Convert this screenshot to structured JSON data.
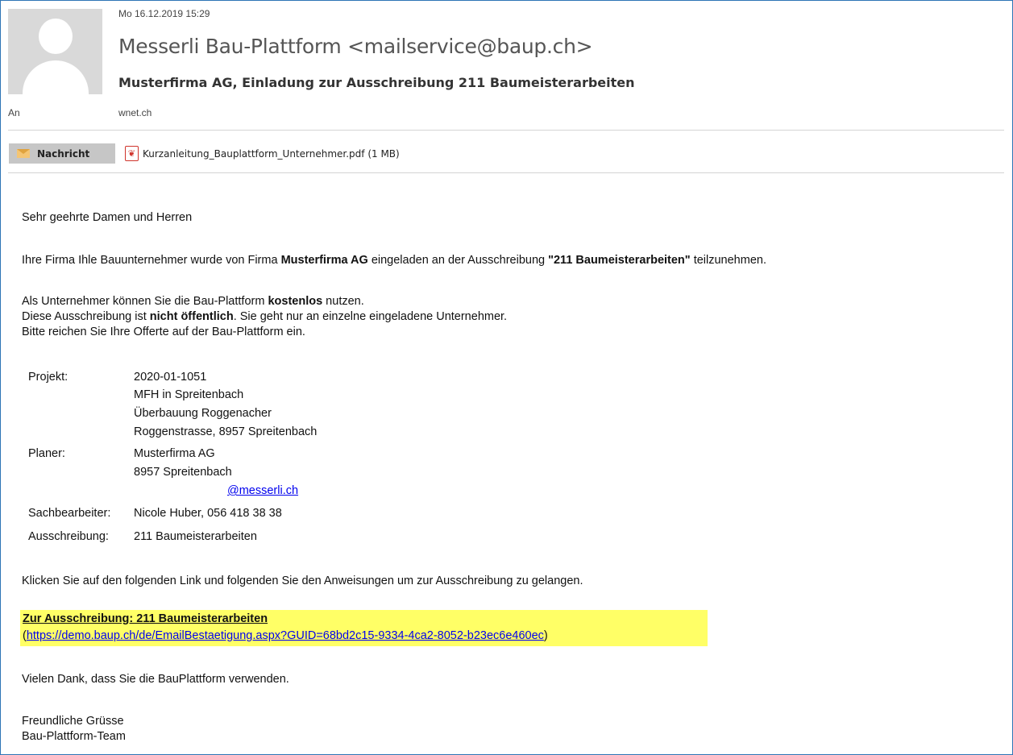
{
  "header": {
    "date": "Mo 16.12.2019 15:29",
    "sender": "Messerli Bau-Plattform <mailservice@baup.ch>",
    "subject": "Musterfirma AG, Einladung zur Ausschreibung 211 Baumeisterarbeiten",
    "to_label": "An",
    "to_value": "wnet.ch"
  },
  "tabs": {
    "message_label": "Nachricht",
    "attachment_name": "Kurzanleitung_Bauplattform_Unternehmer.pdf (1 MB)"
  },
  "body": {
    "greeting": "Sehr geehrte Damen und Herren",
    "intro_1": "Ihre Firma Ihle Bauunternehmer wurde von Firma ",
    "intro_company": "Musterfirma AG",
    "intro_2": " eingeladen an der Ausschreibung ",
    "intro_tender": "\"211 Baumeisterarbeiten\"",
    "intro_3": " teilzunehmen.",
    "free_1": "Als Unternehmer können Sie die Bau-Plattform ",
    "free_bold": "kostenlos",
    "free_2": " nutzen.",
    "private_1": "Diese Ausschreibung ist ",
    "private_bold": "nicht öffentlich",
    "private_2": ". Sie geht nur an einzelne eingeladene Unternehmer.",
    "submit": "Bitte reichen Sie Ihre Offerte auf der Bau-Plattform ein.",
    "details": {
      "project_label": "Projekt:",
      "project_lines": [
        "2020-01-1051",
        "MFH in Spreitenbach",
        "Überbauung Roggenacher",
        "Roggenstrasse, 8957 Spreitenbach"
      ],
      "planner_label": "Planer:",
      "planner_lines": [
        "Musterfirma AG",
        "8957 Spreitenbach"
      ],
      "planner_email_visible": "@messerli.ch",
      "clerk_label": "Sachbearbeiter:",
      "clerk_value": "Nicole Huber, 056 418 38 38",
      "tender_label": "Ausschreibung:",
      "tender_value": "211 Baumeisterarbeiten"
    },
    "instruction": "Klicken Sie auf den folgenden Link und folgenden Sie den Anweisungen um zur Ausschreibung zu gelangen.",
    "link_title": "Zur Ausschreibung: 211 Baumeisterarbeiten",
    "link_url": "https://demo.baup.ch/de/EmailBestaetigung.aspx?GUID=68bd2c15-9334-4ca2-8052-b23ec6e460ec",
    "thanks": "Vielen Dank, dass Sie die BauPlattform verwenden.",
    "closing": "Freundliche Grüsse",
    "signature": "Bau-Plattform-Team"
  },
  "colors": {
    "highlight": "#ffff66",
    "frame_border": "#2e75b6",
    "link": "#0000ee"
  }
}
